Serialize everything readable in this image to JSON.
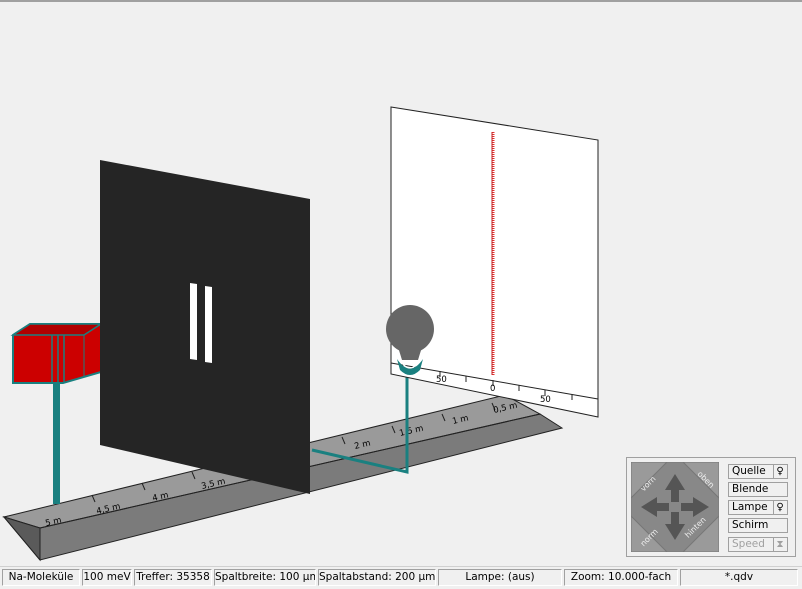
{
  "ruler": {
    "labels": [
      "5 m",
      "4,5 m",
      "4 m",
      "3,5 m",
      "2 m",
      "1,5 m",
      "1 m",
      "0,5 m"
    ]
  },
  "screen": {
    "scale_labels": [
      "50",
      "0",
      "50"
    ]
  },
  "controls": {
    "nav": {
      "vorn": "vorn",
      "oben": "oben",
      "norm": "norm",
      "hinten": "hinten"
    },
    "buttons": {
      "quelle": "Quelle",
      "blende": "Blende",
      "lampe": "Lampe",
      "schirm": "Schirm",
      "speed": "Speed"
    }
  },
  "status": {
    "particle": "Na-Moleküle",
    "energy": "100 meV",
    "hits": "Treffer: 35358",
    "slit_width": "Spaltbreite: 100 µm",
    "slit_distance": "Spaltabstand: 200 µm",
    "lamp": "Lampe: (aus)",
    "zoom": "Zoom: 10.000-fach",
    "file": "*.qdv"
  },
  "colors": {
    "source": "#cc0000",
    "teal": "#1a8080",
    "slit_plate": "#252525",
    "ruler": "#7b7b7b",
    "pattern": "#e03030"
  }
}
